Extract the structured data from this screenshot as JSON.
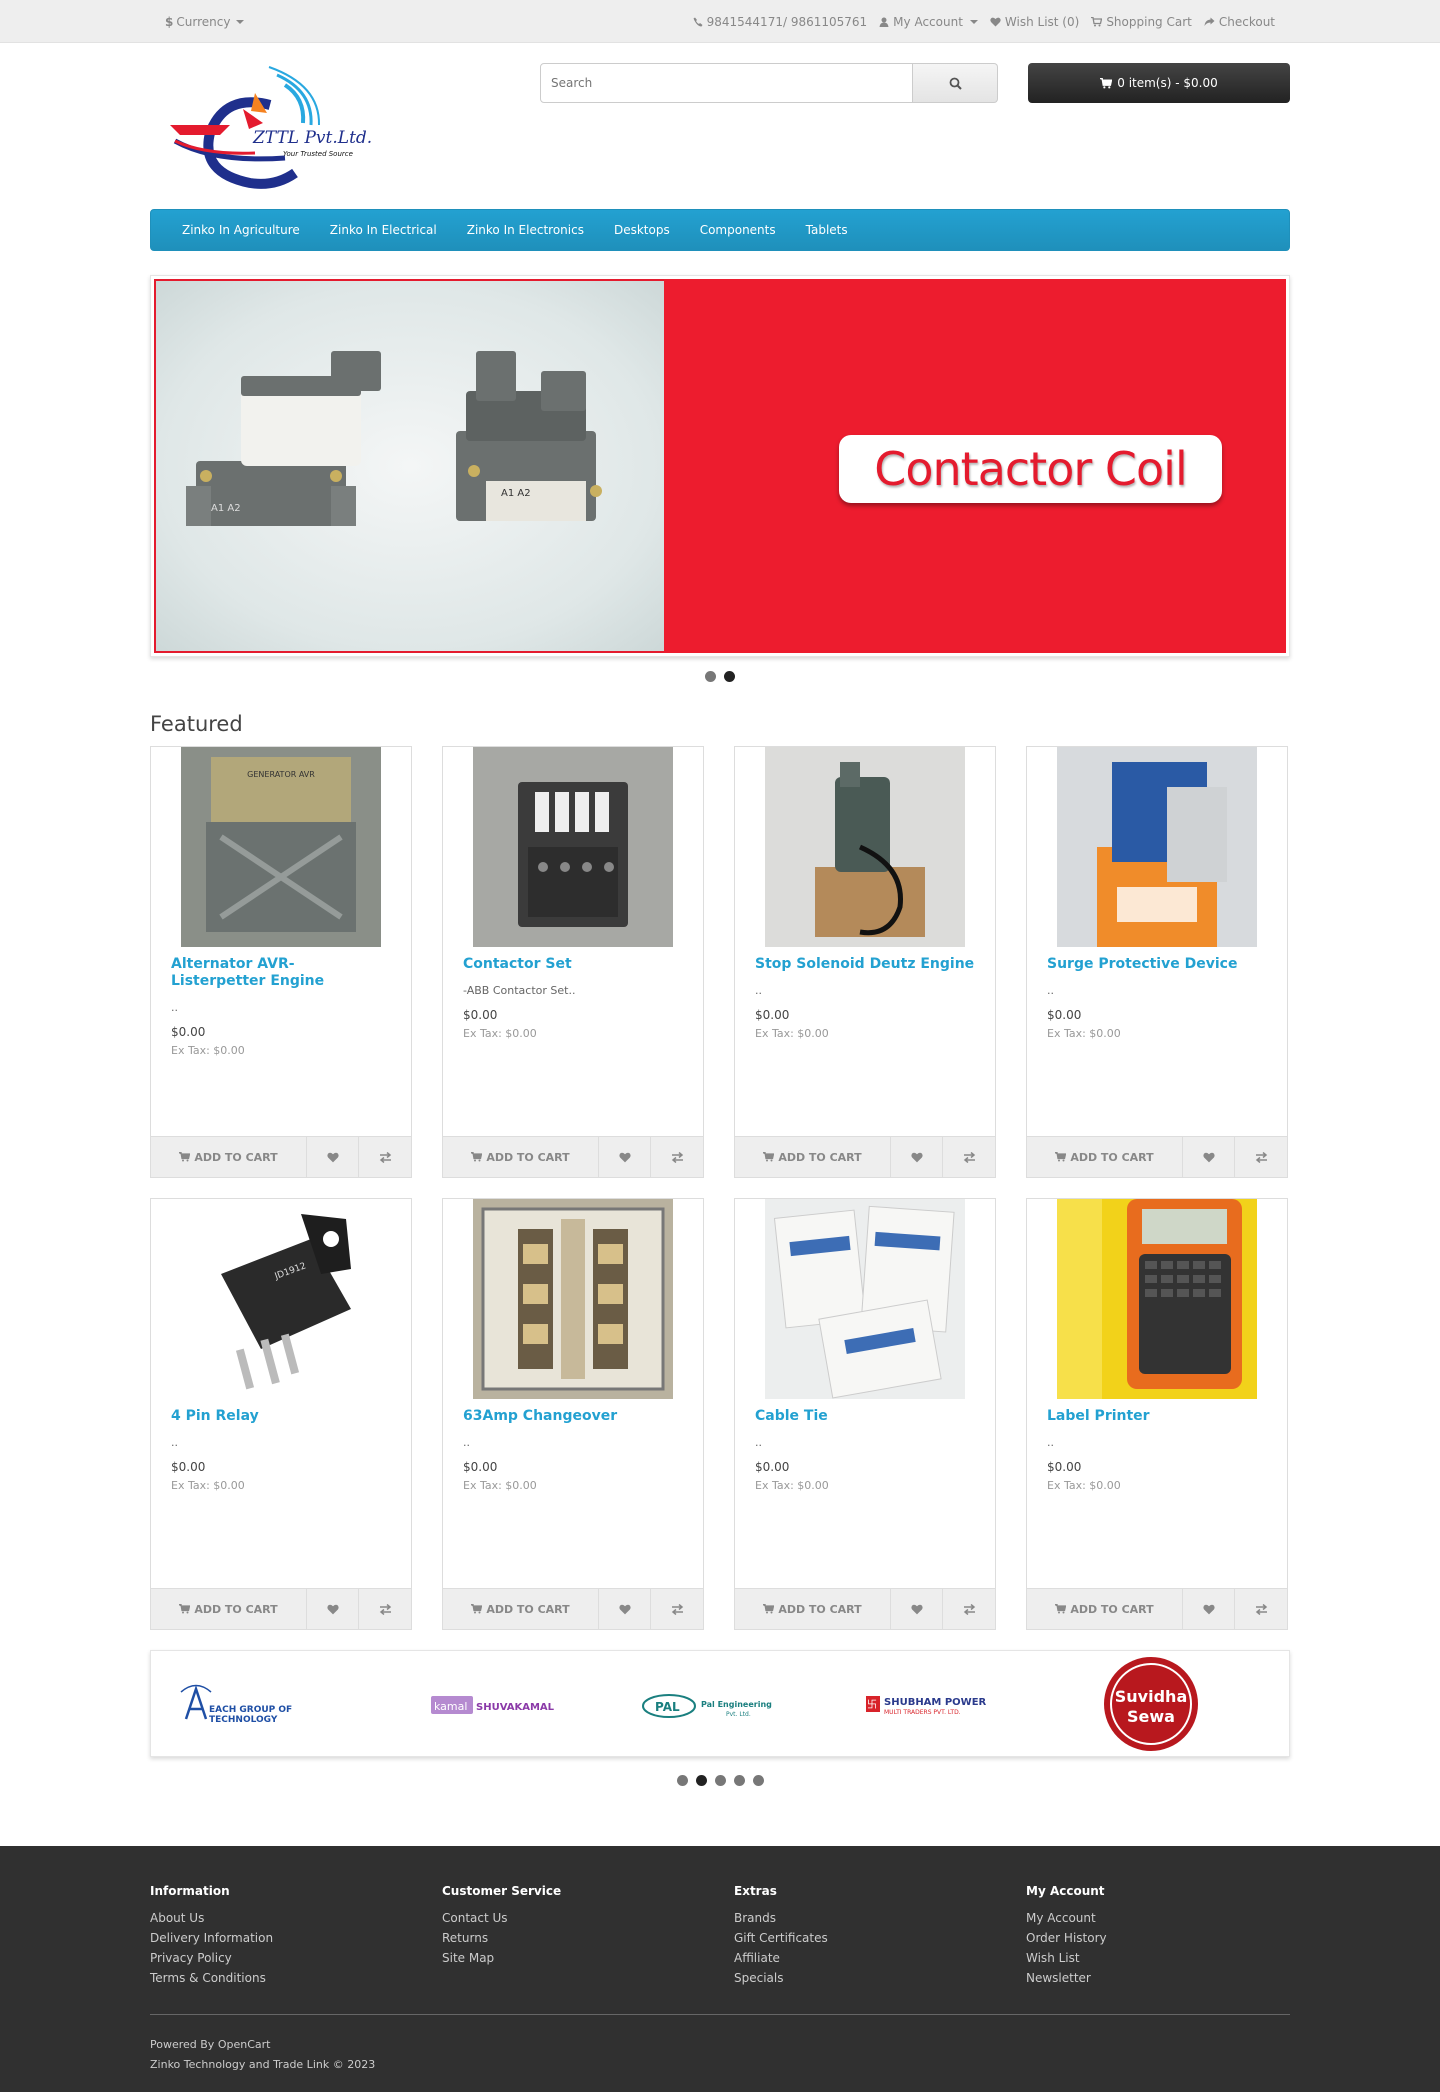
{
  "top": {
    "currency": "Currency",
    "currency_symbol": "$",
    "phone": "9841544171/ 9861105761",
    "my_account": "My Account",
    "wish_list": "Wish List (0)",
    "shopping_cart": "Shopping Cart",
    "checkout": "Checkout"
  },
  "logo": {
    "brand": "ZTTL Pvt.Ltd.",
    "tagline": "Your Trusted Source"
  },
  "search": {
    "placeholder": "Search"
  },
  "cart": {
    "label": "0 item(s) - $0.00"
  },
  "menu": [
    "Zinko In Agriculture",
    "Zinko In Electrical",
    "Zinko In Electronics",
    "Desktops",
    "Components",
    "Tablets"
  ],
  "slide": {
    "caption": "Contactor Coil"
  },
  "featured": {
    "title": "Featured",
    "add_to_cart": "ADD TO CART",
    "products": [
      {
        "name": "Alternator AVR- Listerpetter Engine",
        "desc": "..",
        "price": "$0.00",
        "tax": "Ex Tax: $0.00"
      },
      {
        "name": "Contactor Set",
        "desc": "-ABB Contactor Set..",
        "price": "$0.00",
        "tax": "Ex Tax: $0.00"
      },
      {
        "name": "Stop Solenoid Deutz Engine",
        "desc": "..",
        "price": "$0.00",
        "tax": "Ex Tax: $0.00"
      },
      {
        "name": "Surge Protective Device",
        "desc": "..",
        "price": "$0.00",
        "tax": "Ex Tax: $0.00"
      },
      {
        "name": "4 Pin Relay",
        "desc": "..",
        "price": "$0.00",
        "tax": "Ex Tax: $0.00"
      },
      {
        "name": "63Amp Changeover",
        "desc": "..",
        "price": "$0.00",
        "tax": "Ex Tax: $0.00"
      },
      {
        "name": "Cable Tie",
        "desc": "..",
        "price": "$0.00",
        "tax": "Ex Tax: $0.00"
      },
      {
        "name": "Label Printer",
        "desc": "..",
        "price": "$0.00",
        "tax": "Ex Tax: $0.00"
      }
    ]
  },
  "brands": [
    {
      "name": "EACH GROUP OF TECHNOLOGY"
    },
    {
      "name": "SHUVAKAMAL"
    },
    {
      "name": "Pal Engineering Pvt. Ltd."
    },
    {
      "name": "SHUBHAM POWER",
      "sub": "MULTI TRADERS PVT. LTD."
    },
    {
      "name": "Suvidha",
      "sub": "Sewa"
    }
  ],
  "footer": {
    "columns": [
      {
        "title": "Information",
        "links": [
          "About Us",
          "Delivery Information",
          "Privacy Policy",
          "Terms & Conditions"
        ]
      },
      {
        "title": "Customer Service",
        "links": [
          "Contact Us",
          "Returns",
          "Site Map"
        ]
      },
      {
        "title": "Extras",
        "links": [
          "Brands",
          "Gift Certificates",
          "Affiliate",
          "Specials"
        ]
      },
      {
        "title": "My Account",
        "links": [
          "My Account",
          "Order History",
          "Wish List",
          "Newsletter"
        ]
      }
    ],
    "powered_by": "Powered By",
    "powered_link": "OpenCart",
    "copyright": "Zinko Technology and Trade Link © 2023"
  },
  "colors": {
    "accent": "#23a1d1",
    "slide_red": "#ed1c2e",
    "footer_bg": "#303030"
  }
}
